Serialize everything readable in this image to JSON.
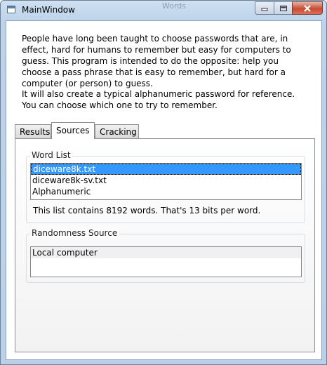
{
  "window": {
    "title": "MainWindow",
    "background_hint": "Words"
  },
  "intro": {
    "paragraph1": "People have long been taught to choose passwords that are, in effect, hard for humans to remember but easy for computers to guess. This program is intended to do the opposite: help you choose a pass phrase that is easy to remember, but hard for a computer (or person) to guess.",
    "paragraph2": "It will also create a typical alphanumeric password for reference. You can choose which one to try to remember."
  },
  "tabs": [
    {
      "label": "Results"
    },
    {
      "label": "Sources",
      "active": true
    },
    {
      "label": "Cracking"
    }
  ],
  "word_list": {
    "legend": "Word List",
    "items": [
      "diceware8k.txt",
      "diceware8k-sv.txt",
      "Alphanumeric"
    ],
    "selected": "diceware8k.txt",
    "info": "This list contains 8192 words. That's 13 bits per word."
  },
  "randomness": {
    "legend": "Randomness Source",
    "items": [
      "Local computer"
    ]
  },
  "colors": {
    "selection": "#3399ff",
    "frame": "#b9d0e8",
    "close_button": "#c84b33"
  },
  "icons": [
    "app-icon",
    "minimize-icon",
    "maximize-icon",
    "close-icon"
  ]
}
